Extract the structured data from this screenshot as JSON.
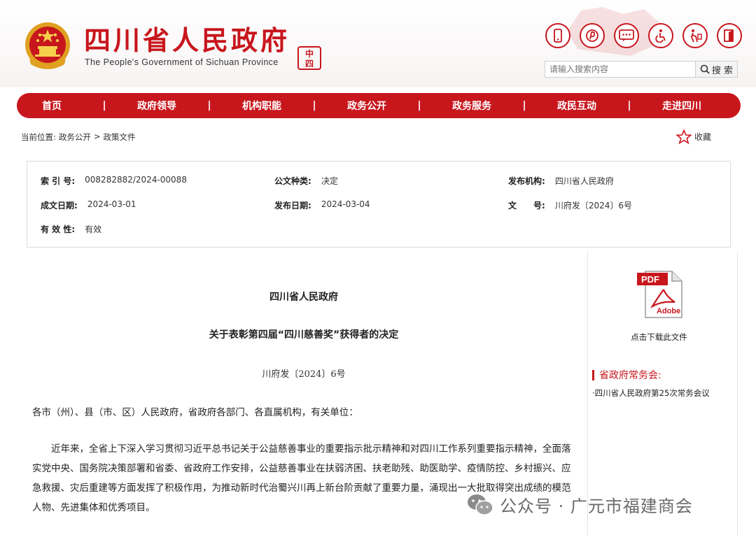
{
  "header": {
    "title": "四川省人民政府",
    "subtitle": "The People's Government of Sichuan Province",
    "seal_text": "中国四川",
    "icons": [
      "mobile-icon",
      "weibo-icon",
      "message-icon",
      "accessibility-icon",
      "elderly-mode-icon",
      "exit-icon"
    ],
    "search_placeholder": "请输入搜索内容",
    "search_label": "搜 索"
  },
  "nav": {
    "items": [
      "首页",
      "政府领导",
      "机构职能",
      "政务公开",
      "政务服务",
      "政民互动",
      "走进四川"
    ],
    "separator": "|"
  },
  "breadcrumb": {
    "prefix": "当前位置:",
    "items": [
      "政务公开",
      "政策文件"
    ],
    "separator": ">"
  },
  "favorite_label": "收藏",
  "info": {
    "index_label": "索 引 号:",
    "index_value": "008282882/2024-00088",
    "type_label": "公文种类:",
    "type_value": "决定",
    "issuer_label": "发布机构:",
    "issuer_value": "四川省人民政府",
    "created_label": "成文日期:",
    "created_value": "2024-03-01",
    "published_label": "发布日期:",
    "published_value": "2024-03-04",
    "docno_label": "文　　号:",
    "docno_value": "川府发〔2024〕6号",
    "validity_label": "有 效 性:",
    "validity_value": "有效"
  },
  "document": {
    "org": "四川省人民政府",
    "title": "关于表彰第四届“四川慈善奖”获得者的决定",
    "number": "川府发〔2024〕6号",
    "salutation": "各市（州）、县（市、区）人民政府，省政府各部门、各直属机构，有关单位：",
    "body": "近年来，全省上下深入学习贯彻习近平总书记关于公益慈善事业的重要指示批示精神和对四川工作系列重要指示精神，全面落实党中央、国务院决策部署和省委、省政府工作安排，公益慈善事业在扶弱济困、扶老助残、助医助学、疫情防控、乡村振兴、应急救援、灾后重建等方面发挥了积极作用，为推动新时代治蜀兴川再上新台阶贡献了重要力量，涌现出一大批取得突出成绩的模范人物、先进集体和优秀项目。"
  },
  "sidebar": {
    "pdf_top": "PDF",
    "pdf_bottom": "Adobe",
    "download_label": "点击下载此文件",
    "meeting_heading": "省政府常务会:",
    "meeting_item": "·四川省人民政府第25次常务会议"
  },
  "watermark": {
    "text": "公众号 · 广元市福建商会"
  },
  "colors": {
    "brand_red": "#c8161d",
    "border": "#dcdcdc"
  }
}
